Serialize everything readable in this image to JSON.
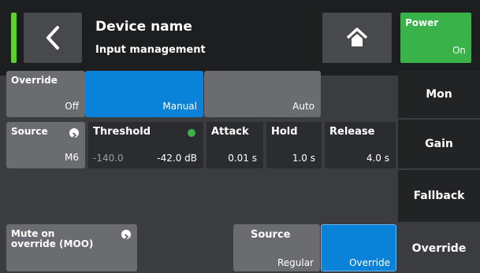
{
  "header": {
    "title": "Device name",
    "subtitle": "Input management",
    "power": {
      "label": "Power",
      "value": "On"
    }
  },
  "override": {
    "label": "Override",
    "value": "Off"
  },
  "mode_options": [
    {
      "label": "Manual",
      "selected": true
    },
    {
      "label": "Auto",
      "selected": false
    }
  ],
  "source": {
    "label": "Source",
    "value": "M6"
  },
  "threshold": {
    "label": "Threshold",
    "min": "-140.0",
    "value": "-42.0 dB"
  },
  "attack": {
    "label": "Attack",
    "value": "0.01 s"
  },
  "hold": {
    "label": "Hold",
    "value": "1.0 s"
  },
  "release": {
    "label": "Release",
    "value": "4.0 s"
  },
  "moo": {
    "label_line1": "Mute on",
    "label_line2": "override (MOO)"
  },
  "source_mode": {
    "label": "Source",
    "options": [
      "Regular",
      "Override"
    ],
    "selected": "Override"
  },
  "sidebar": [
    "Mon",
    "Gain",
    "Fallback",
    "Override"
  ],
  "colors": {
    "accent_blue": "#0a82d8",
    "power_green": "#39b24a",
    "status_green": "#5fd12f"
  },
  "icons": [
    "chevron-left-icon",
    "home-icon",
    "circle-arrow-icon"
  ]
}
